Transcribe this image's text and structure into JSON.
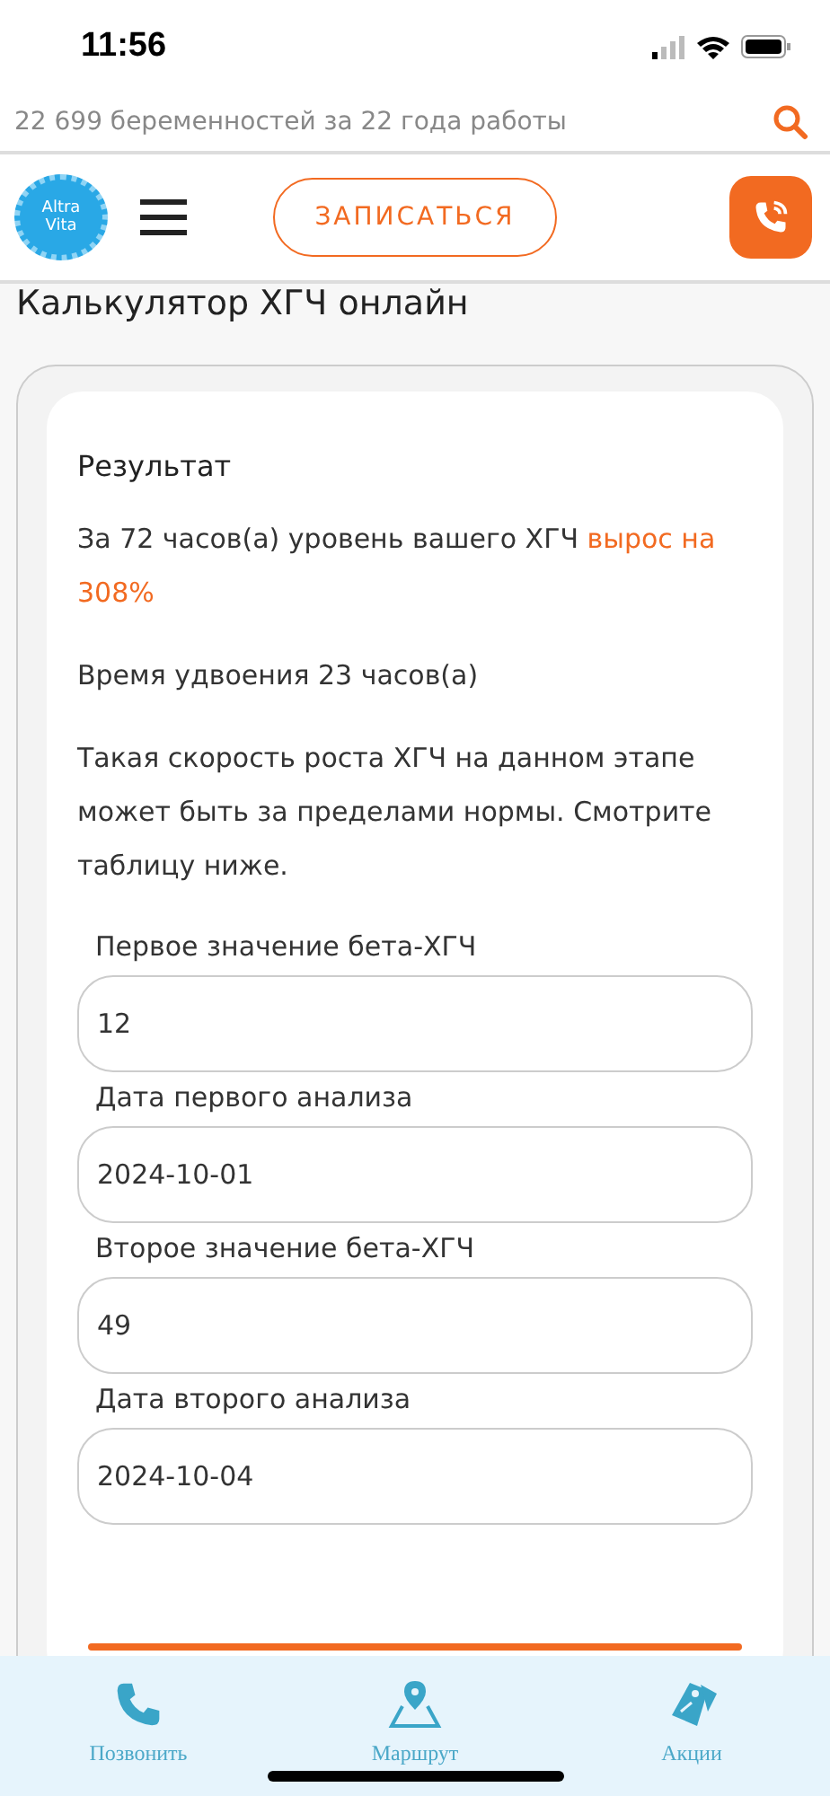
{
  "status_bar": {
    "time": "11:56"
  },
  "top_strip": {
    "text": "22 699 беременностей за 22 года работы"
  },
  "header": {
    "logo_line1": "Altra",
    "logo_line2": "Vita",
    "book_button": "ЗАПИСАТЬСЯ"
  },
  "page_title": "Калькулятор ХГЧ онлайн",
  "result": {
    "heading": "Результат",
    "growth_text": "За 72 часов(а) уровень вашего ХГЧ ",
    "growth_highlight": "вырос на 308%",
    "doubling": "Время удвоения 23 часов(а)",
    "note": "Такая скорость роста ХГЧ на данном этапе может быть за пределами нормы. Смотрите таблицу ниже."
  },
  "fields": [
    {
      "label": "Первое значение бета-ХГЧ",
      "value": "12"
    },
    {
      "label": "Дата первого анализа",
      "value": "2024-10-01"
    },
    {
      "label": "Второе значение бета-ХГЧ",
      "value": "49"
    },
    {
      "label": "Дата второго анализа",
      "value": "2024-10-04"
    }
  ],
  "bottom_nav": [
    {
      "label": "Позвонить",
      "kind": "phone"
    },
    {
      "label": "Маршрут",
      "kind": "route"
    },
    {
      "label": "Акции",
      "kind": "tag"
    }
  ]
}
